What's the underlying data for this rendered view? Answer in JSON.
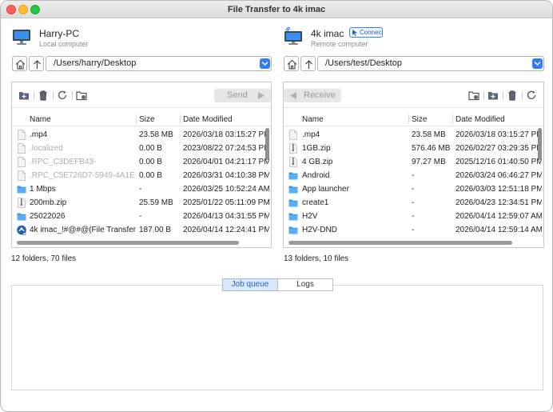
{
  "window": {
    "title": "File Transfer to 4k imac"
  },
  "local": {
    "name": "Harry-PC",
    "subtitle": "Local computer",
    "path": "/Users/harry/Desktop",
    "action_label": "Send",
    "columns": [
      "Name",
      "Size",
      "Date Modified"
    ],
    "rows": [
      {
        "name": ".mp4",
        "size": "23.58 MB",
        "date": "2026/03/18 03:15:27 PM",
        "icon": "file-icon",
        "dim": false
      },
      {
        "name": ".localized",
        "size": "0.00 B",
        "date": "2023/08/22 07:24:53 PM",
        "icon": "file-icon",
        "dim": true
      },
      {
        "name": ".RPC_C3DEFB43-",
        "size": "0.00 B",
        "date": "2026/04/01 04:21:17 PM",
        "icon": "file-icon",
        "dim": true
      },
      {
        "name": ".RPC_C5E726D7-5949-4A1E-",
        "size": "0.00 B",
        "date": "2026/03/31 04:10:38 PM",
        "icon": "file-icon",
        "dim": true
      },
      {
        "name": "1 Mbps",
        "size": "-",
        "date": "2026/03/25 10:52:24 AM",
        "icon": "folder-icon",
        "dim": false
      },
      {
        "name": "200mb.zip",
        "size": "25.59 MB",
        "date": "2025/01/22 05:11:09 PM",
        "icon": "zip-icon",
        "dim": false
      },
      {
        "name": "25022026",
        "size": "-",
        "date": "2026/04/13 04:31:55 PM",
        "icon": "folder-icon",
        "dim": false
      },
      {
        "name": "4k imac_!#@#@(File Transfer",
        "size": "187.00 B",
        "date": "2026/04/14 12:24:41 PM",
        "icon": "app-icon",
        "dim": false
      }
    ],
    "status": "12 folders, 70 files"
  },
  "remote": {
    "name": "4k imac",
    "subtitle": "Remote computer",
    "connect_label": "Connect",
    "path": "/Users/test/Desktop",
    "action_label": "Receive",
    "columns": [
      "Name",
      "Size",
      "Date Modified"
    ],
    "rows": [
      {
        "name": ".mp4",
        "size": "23.58 MB",
        "date": "2026/03/18 03:15:27 PM",
        "icon": "file-icon",
        "dim": false
      },
      {
        "name": "1GB.zip",
        "size": "576.46 MB",
        "date": "2026/02/27 03:29:35 PM",
        "icon": "zip-icon",
        "dim": false
      },
      {
        "name": "4 GB.zip",
        "size": "97.27 MB",
        "date": "2025/12/16 01:40:50 PM",
        "icon": "zip-icon",
        "dim": false
      },
      {
        "name": "Android",
        "size": "-",
        "date": "2026/03/24 06:46:27 PM",
        "icon": "folder-icon",
        "dim": false
      },
      {
        "name": "App launcher",
        "size": "-",
        "date": "2026/03/03 12:51:18 PM",
        "icon": "folder-icon",
        "dim": false
      },
      {
        "name": "create1",
        "size": "-",
        "date": "2026/04/23 12:34:51 PM",
        "icon": "folder-icon",
        "dim": false
      },
      {
        "name": "H2V",
        "size": "-",
        "date": "2026/04/14 12:59:07 AM",
        "icon": "folder-icon",
        "dim": false
      },
      {
        "name": "H2V-DND",
        "size": "-",
        "date": "2026/04/14 12:59:14 AM",
        "icon": "folder-icon",
        "dim": false
      }
    ],
    "status": "13 folders, 10 files"
  },
  "bottom": {
    "tab_job_queue": "Job queue",
    "tab_logs": "Logs"
  },
  "colors": {
    "accent": "#2f7cf6",
    "folder": "#3b9af0",
    "close": "#fe5f57",
    "minimize": "#febc2e",
    "maximize": "#28c840"
  }
}
